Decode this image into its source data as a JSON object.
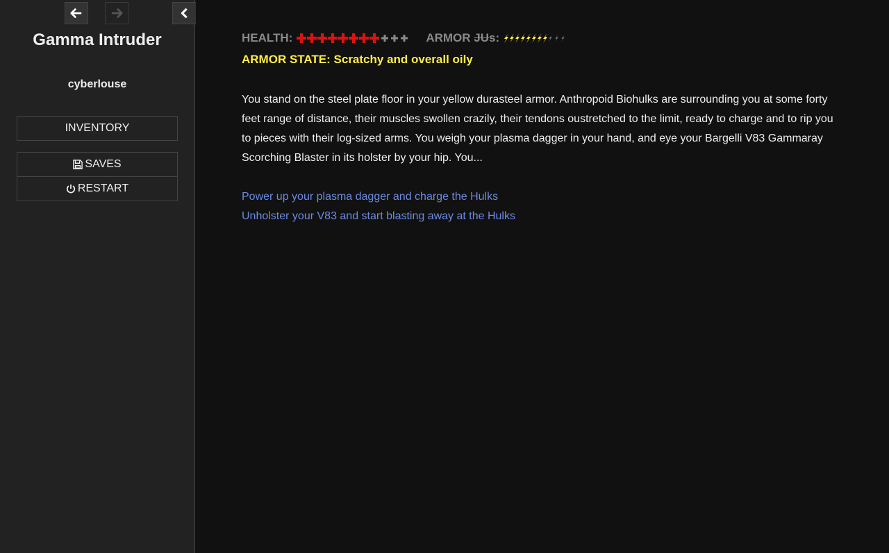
{
  "sidebar": {
    "title": "Gamma Intruder",
    "author": "cyberlouse",
    "inventory_label": "INVENTORY",
    "saves_label": "SAVES",
    "restart_label": "RESTART"
  },
  "stats": {
    "health_label": "HEALTH:",
    "health_current": 8,
    "health_max": 11,
    "armor_label_prefix": "ARMOR ",
    "armor_label_strike": "JU",
    "armor_label_suffix": "s:",
    "armor_current": 8,
    "armor_max": 11,
    "health_color": "#dd1111",
    "armor_color": "#ffee44"
  },
  "armor_state": "ARMOR STATE: Scratchy and overall oily",
  "story_text": "You stand on the steel plate floor in your yellow durasteel armor. Anthropoid Biohulks are surrounding you at some forty feet range of distance, their muscles swollen crazily, their tendons oustretched to the limit, ready to charge and to rip you to pieces with their log-sized arms. You weigh your plasma dagger in your hand, and eye your Bargelli V83 Gammaray Scorching Blaster in its holster by your hip. You...",
  "choices": [
    "Power up your plasma dagger and charge the Hulks",
    "Unholster your V83 and start blasting away at the Hulks"
  ],
  "icons": {
    "back": "arrow-left-icon",
    "forward": "arrow-right-icon",
    "toggle": "chevron-left-icon",
    "saves": "floppy-disk-icon",
    "restart": "power-icon",
    "health": "cross-icon",
    "armor": "lightning-icon"
  },
  "colors": {
    "background": "#111111",
    "sidebar": "#222222",
    "link": "#6c8ae4"
  }
}
